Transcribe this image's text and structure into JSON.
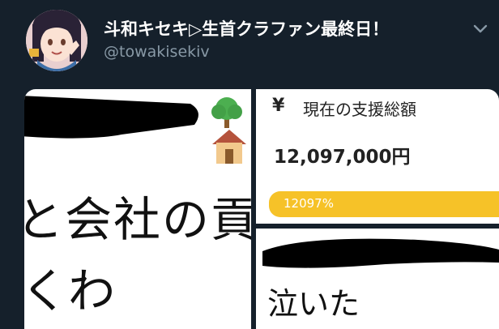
{
  "tweet": {
    "author": {
      "display_name": "斗和キセキ▷生首クラファン最終日！",
      "handle": "@towakisekiv"
    },
    "menu_icon": "chevron-down-icon"
  },
  "media": {
    "left_image": {
      "line1": "と会社の貢",
      "line2": "くわ",
      "emoji": "🌳🏠"
    },
    "crowdfunding_card": {
      "currency_symbol": "¥",
      "label": "現在の支援総額",
      "amount": "12,097,000円",
      "progress_text": "12097%",
      "progress_fraction": 1.0
    },
    "bottom_image": {
      "text": "泣いた"
    }
  },
  "colors": {
    "background": "#15202b",
    "text_primary": "#ffffff",
    "text_secondary": "#8899a6",
    "progress": "#f6c228",
    "redaction": "#000000"
  }
}
